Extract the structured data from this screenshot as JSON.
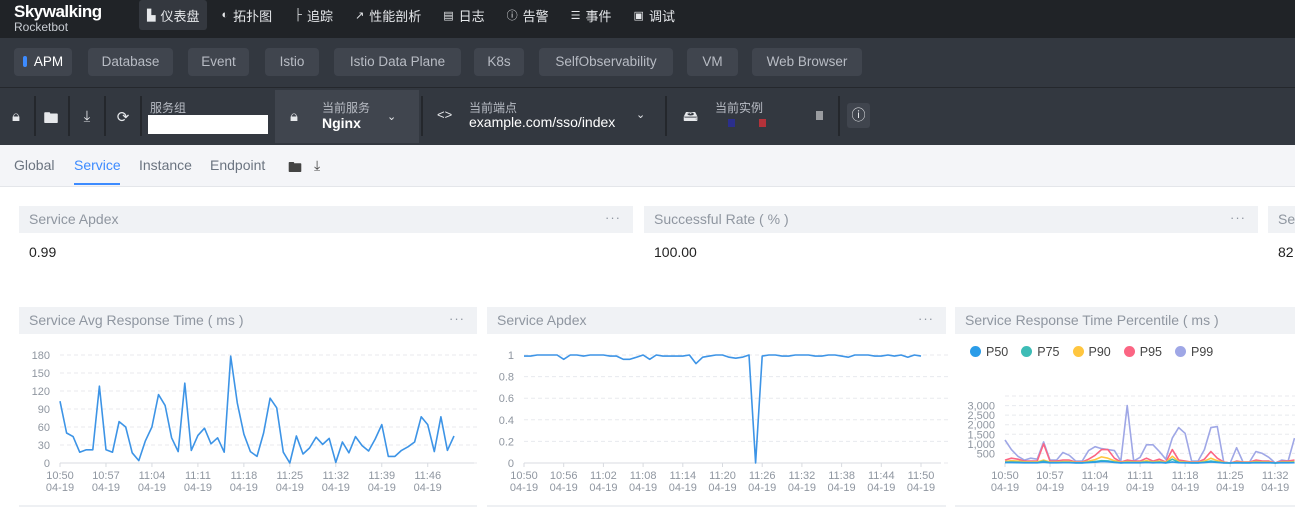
{
  "app": {
    "logo_line1": "Skywalking",
    "logo_line2": "Rocketbot"
  },
  "nav": [
    {
      "label": "仪表盘",
      "icon": "chart-icon",
      "active": true
    },
    {
      "label": "拓扑图",
      "icon": "topology-icon"
    },
    {
      "label": "追踪",
      "icon": "trace-icon"
    },
    {
      "label": "性能剖析",
      "icon": "profile-icon"
    },
    {
      "label": "日志",
      "icon": "log-icon"
    },
    {
      "label": "告警",
      "icon": "alarm-icon"
    },
    {
      "label": "事件",
      "icon": "event-icon"
    },
    {
      "label": "调试",
      "icon": "debug-icon"
    }
  ],
  "layers": [
    "APM",
    "Database",
    "Event",
    "Istio",
    "Istio Data Plane",
    "K8s",
    "SelfObservability",
    "VM",
    "Web Browser"
  ],
  "active_layer": "APM",
  "toolbar": {
    "service_group_label": "服务组",
    "service_group_value": "",
    "service_label": "当前服务",
    "service_value": "Nginx",
    "endpoint_label": "当前端点",
    "endpoint_value": "example.com/sso/index",
    "instance_label": "当前实例",
    "instance_colors": [
      "#2b2f8c",
      "#b3323a",
      "#9a9ca0"
    ]
  },
  "tabs": [
    "Global",
    "Service",
    "Instance",
    "Endpoint"
  ],
  "active_tab": "Service",
  "cards": [
    {
      "title": "Service Apdex",
      "value": "0.99"
    },
    {
      "title": "Successful Rate ( % )",
      "value": "100.00"
    },
    {
      "title": "Ser",
      "value": "82"
    }
  ],
  "colors": {
    "line": "#3d94e6",
    "accent": "#3d8bff"
  },
  "chart_data": [
    {
      "type": "line",
      "title": "Service Avg Response Time ( ms )",
      "ylim": [
        0,
        180
      ],
      "yticks": [
        "0",
        "30",
        "60",
        "90",
        "120",
        "150",
        "180"
      ],
      "xtick_labels": [
        [
          "10:50",
          "04-19"
        ],
        [
          "10:57",
          "04-19"
        ],
        [
          "11:04",
          "04-19"
        ],
        [
          "11:11",
          "04-19"
        ],
        [
          "11:18",
          "04-19"
        ],
        [
          "11:25",
          "04-19"
        ],
        [
          "11:32",
          "04-19"
        ],
        [
          "11:39",
          "04-19"
        ],
        [
          "11:46",
          "04-19"
        ]
      ],
      "x_range": [
        "10:50",
        "11:50"
      ],
      "grid": true,
      "series": [
        {
          "color": "#3d94e6",
          "values": [
            103,
            50,
            44,
            18,
            22,
            22,
            128,
            22,
            18,
            69,
            60,
            17,
            4,
            37,
            60,
            114,
            96,
            42,
            19,
            133,
            21,
            46,
            58,
            32,
            42,
            18,
            178,
            100,
            48,
            19,
            11,
            50,
            108,
            92,
            18,
            0,
            45,
            15,
            25,
            43,
            31,
            41,
            1,
            35,
            17,
            44,
            29,
            20,
            40,
            64,
            11,
            11,
            21,
            27,
            35,
            77,
            64,
            19,
            77,
            21,
            45
          ]
        }
      ]
    },
    {
      "type": "line",
      "title": "Service Apdex",
      "ylim": [
        0,
        1
      ],
      "yticks": [
        "0",
        "0.2",
        "0.4",
        "0.6",
        "0.8",
        "1"
      ],
      "xtick_labels": [
        [
          "10:50",
          "04-19"
        ],
        [
          "10:56",
          "04-19"
        ],
        [
          "11:02",
          "04-19"
        ],
        [
          "11:08",
          "04-19"
        ],
        [
          "11:14",
          "04-19"
        ],
        [
          "11:20",
          "04-19"
        ],
        [
          "11:26",
          "04-19"
        ],
        [
          "11:32",
          "04-19"
        ],
        [
          "11:38",
          "04-19"
        ],
        [
          "11:44",
          "04-19"
        ],
        [
          "11:50",
          "04-19"
        ]
      ],
      "x_range": [
        "10:50",
        "11:50"
      ],
      "grid": true,
      "series": [
        {
          "color": "#3d94e6",
          "values": [
            0.99,
            0.99,
            1,
            1,
            1,
            1,
            0.96,
            1,
            1,
            0.99,
            1,
            1,
            1,
            0.99,
            0.99,
            0.96,
            0.96,
            0.98,
            1,
            0.96,
            1,
            0.99,
            0.99,
            0.99,
            0.99,
            1,
            0.92,
            0.98,
            0.99,
            1,
            1,
            0.98,
            0.97,
            0.98,
            1,
            0,
            0.99,
            1,
            1,
            0.99,
            0.99,
            1,
            1,
            1,
            0.99,
            0.99,
            1,
            1,
            0.99,
            0.98,
            1,
            1,
            1,
            0.99,
            0.99,
            1,
            0.99,
            1,
            0.98,
            1,
            0.99
          ]
        }
      ]
    },
    {
      "type": "line",
      "title": "Service Response Time Percentile ( ms )",
      "ylim": [
        0,
        3500
      ],
      "yticks": [
        "500",
        "1,000",
        "1,500",
        "2,000",
        "2,500",
        "3,000"
      ],
      "xtick_labels": [
        [
          "10:50",
          "04-19"
        ],
        [
          "10:57",
          "04-19"
        ],
        [
          "11:04",
          "04-19"
        ],
        [
          "11:11",
          "04-19"
        ],
        [
          "11:18",
          "04-19"
        ],
        [
          "11:25",
          "04-19"
        ],
        [
          "11:32",
          "04-19"
        ]
      ],
      "x_range": [
        "10:50",
        "11:50"
      ],
      "grid": true,
      "legend": "top-left",
      "series": [
        {
          "name": "P50",
          "color": "#2a9ce8",
          "values": [
            20,
            20,
            15,
            10,
            10,
            10,
            40,
            10,
            10,
            15,
            15,
            5,
            5,
            20,
            40,
            80,
            70,
            25,
            5,
            15,
            10,
            10,
            25,
            10,
            20,
            5,
            60,
            15,
            10,
            5,
            5,
            20,
            50,
            25,
            5,
            0,
            10,
            5,
            5,
            15,
            10,
            10,
            0,
            10,
            10,
            15
          ]
        },
        {
          "name": "P75",
          "color": "#3dbcb6",
          "values": [
            40,
            50,
            40,
            20,
            20,
            20,
            100,
            20,
            20,
            30,
            30,
            10,
            10,
            40,
            80,
            120,
            110,
            50,
            10,
            30,
            20,
            20,
            50,
            20,
            40,
            10,
            200,
            30,
            20,
            10,
            10,
            40,
            100,
            50,
            10,
            0,
            20,
            10,
            10,
            30,
            20,
            20,
            0,
            20,
            20,
            30
          ]
        },
        {
          "name": "P90",
          "color": "#ffc63f",
          "values": [
            80,
            120,
            100,
            60,
            60,
            60,
            150,
            50,
            50,
            80,
            80,
            30,
            30,
            100,
            180,
            320,
            250,
            120,
            30,
            80,
            50,
            50,
            120,
            50,
            100,
            30,
            350,
            80,
            50,
            30,
            30,
            100,
            250,
            120,
            30,
            0,
            50,
            30,
            30,
            80,
            50,
            50,
            0,
            50,
            50,
            80
          ]
        },
        {
          "name": "P95",
          "color": "#fb6583",
          "values": [
            150,
            250,
            200,
            100,
            100,
            100,
            1000,
            100,
            100,
            150,
            150,
            50,
            50,
            200,
            400,
            700,
            700,
            250,
            50,
            150,
            100,
            100,
            250,
            100,
            200,
            50,
            700,
            150,
            100,
            50,
            50,
            200,
            600,
            250,
            50,
            0,
            100,
            50,
            50,
            150,
            100,
            100,
            0,
            100,
            100,
            150
          ]
        },
        {
          "name": "P99",
          "color": "#9fa7e6",
          "values": [
            1200,
            700,
            350,
            150,
            250,
            200,
            1100,
            150,
            150,
            550,
            400,
            100,
            100,
            650,
            850,
            750,
            700,
            650,
            100,
            3000,
            100,
            300,
            950,
            950,
            600,
            200,
            1300,
            1850,
            1550,
            100,
            100,
            700,
            1850,
            1900,
            50,
            0,
            800,
            50,
            50,
            600,
            500,
            300,
            0,
            150,
            100,
            1300
          ]
        }
      ]
    }
  ]
}
